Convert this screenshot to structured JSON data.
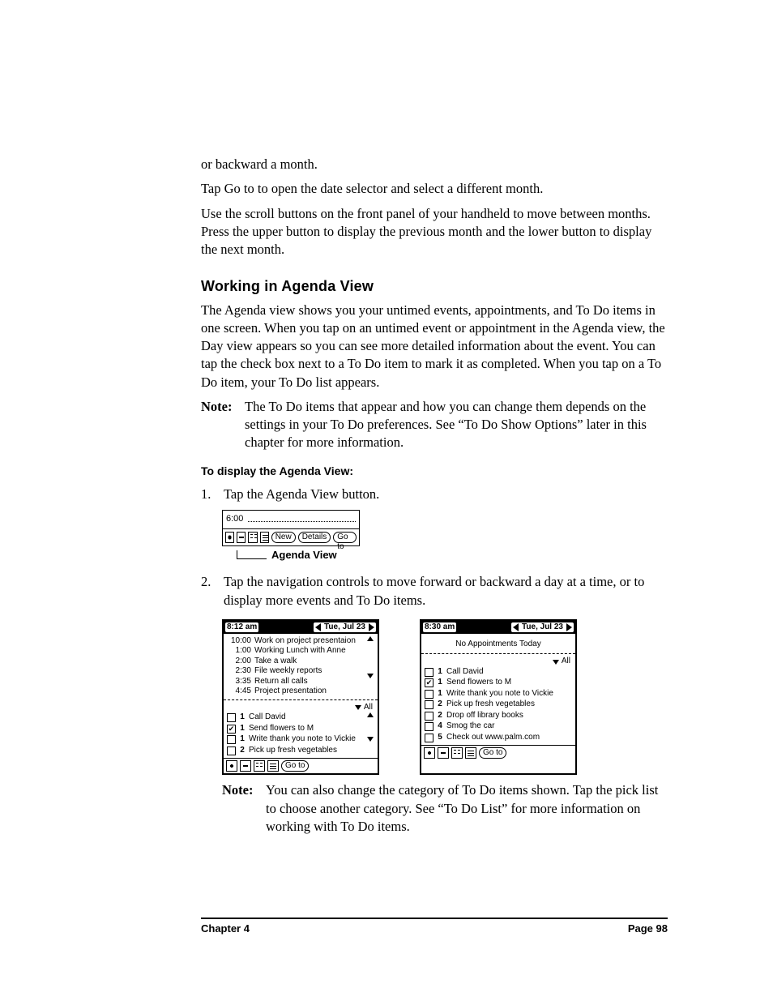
{
  "intro": {
    "p0": "or backward a month.",
    "p1": "Tap Go to to open the date selector and select a different month.",
    "p2": "Use the scroll buttons on the front panel of your handheld to move between months. Press the upper button to display the previous month and the lower button to display the next month."
  },
  "section_title": "Working in Agenda View",
  "section_body": "The Agenda view shows you your untimed events, appointments, and To Do items in one screen. When you tap on an untimed event or appointment in the Agenda view, the Day view appears so you can see more detailed information about the event. You can tap the check box next to a To Do item to mark it as completed. When you tap on a To Do item, your To Do list appears.",
  "note1": {
    "label": "Note:",
    "body": "The To Do items that appear and how you can change them depends on the settings in your To Do preferences. See “To Do Show Options” later in this chapter for more information."
  },
  "sub_heading": "To display the Agenda View:",
  "step1": {
    "num": "1.",
    "text": "Tap the Agenda View button."
  },
  "fig1": {
    "time": "6:00",
    "buttons": {
      "new": "New",
      "details": "Details",
      "goto": "Go to"
    },
    "caption": "Agenda View"
  },
  "step2": {
    "num": "2.",
    "text": "Tap the navigation controls to move forward or backward a day at a time, or to display more events and To Do items."
  },
  "screens": {
    "left": {
      "time": "8:12 am",
      "date": "Tue, Jul 23",
      "appointments": [
        {
          "t": "10:00",
          "d": "Work on project presentaion"
        },
        {
          "t": "1:00",
          "d": "Working Lunch with Anne"
        },
        {
          "t": "2:00",
          "d": "Take a walk"
        },
        {
          "t": "2:30",
          "d": "File weekly reports"
        },
        {
          "t": "3:35",
          "d": "Return all calls"
        },
        {
          "t": "4:45",
          "d": "Project presentation"
        }
      ],
      "category": "All",
      "todos": [
        {
          "chk": false,
          "pri": "1",
          "txt": "Call David"
        },
        {
          "chk": true,
          "pri": "1",
          "txt": "Send flowers to M"
        },
        {
          "chk": false,
          "pri": "1",
          "txt": "Write thank you note to Vickie"
        },
        {
          "chk": false,
          "pri": "2",
          "txt": "Pick up fresh vegetables"
        }
      ],
      "goto": "Go to"
    },
    "right": {
      "time": "8:30 am",
      "date": "Tue, Jul 23",
      "no_appt": "No Appointments Today",
      "category": "All",
      "todos": [
        {
          "chk": false,
          "pri": "1",
          "txt": "Call David"
        },
        {
          "chk": true,
          "pri": "1",
          "txt": "Send flowers to M"
        },
        {
          "chk": false,
          "pri": "1",
          "txt": "Write thank you note to Vickie"
        },
        {
          "chk": false,
          "pri": "2",
          "txt": "Pick up fresh vegetables"
        },
        {
          "chk": false,
          "pri": "2",
          "txt": "Drop off library books"
        },
        {
          "chk": false,
          "pri": "4",
          "txt": "Smog the car"
        },
        {
          "chk": false,
          "pri": "5",
          "txt": "Check out www.palm.com"
        }
      ],
      "goto": "Go to"
    }
  },
  "note2": {
    "label": "Note:",
    "body": "You can also change the category of To Do items shown. Tap the pick list to choose another category. See “To Do List” for more information on working with To Do items."
  },
  "footer": {
    "left": "Chapter 4",
    "right": "Page 98"
  }
}
